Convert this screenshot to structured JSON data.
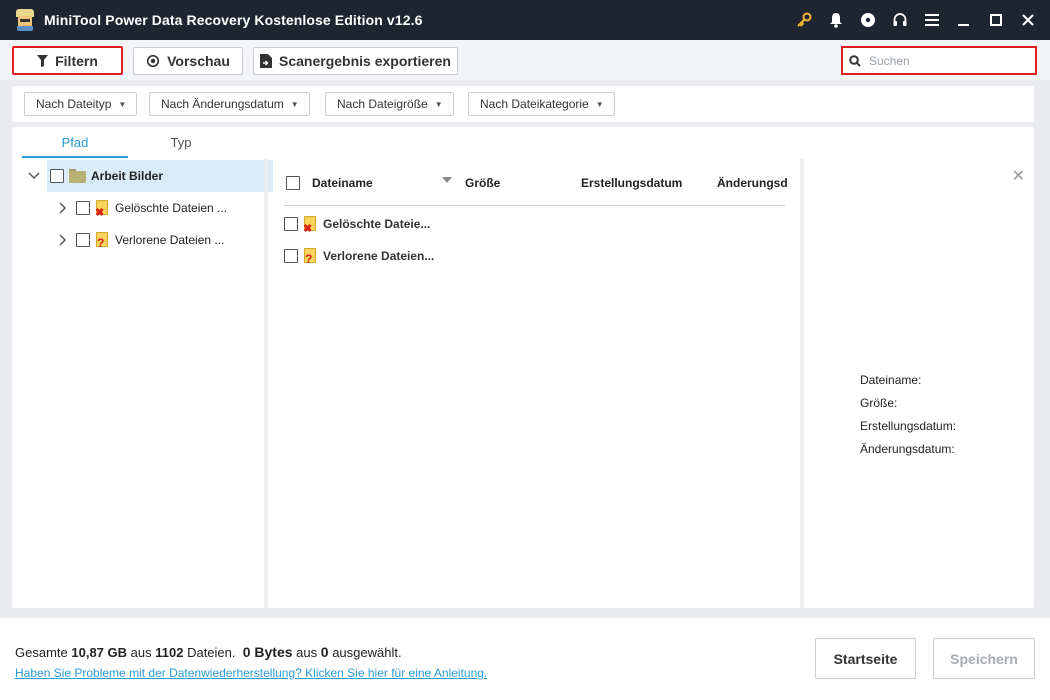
{
  "window": {
    "title": "MiniTool Power Data Recovery Kostenlose Edition v12.6",
    "icons": [
      "key-icon",
      "bell-icon",
      "disc-icon",
      "headset-icon",
      "menu-icon",
      "minimize-icon",
      "maximize-icon",
      "close-icon"
    ]
  },
  "toolbar": {
    "filter_label": "Filtern",
    "preview_label": "Vorschau",
    "export_label": "Scanergebnis exportieren",
    "search_placeholder": "Suchen",
    "search_value": ""
  },
  "filters": [
    {
      "label": "Nach Dateityp"
    },
    {
      "label": "Nach Änderungsdatum"
    },
    {
      "label": "Nach Dateigröße"
    },
    {
      "label": "Nach Dateikategorie"
    }
  ],
  "tabs": [
    {
      "label": "Pfad",
      "active": true
    },
    {
      "label": "Typ",
      "active": false
    }
  ],
  "tree": {
    "root": {
      "label": "Arbeit Bilder"
    },
    "children": [
      {
        "label": "Gelöschte Dateien ..."
      },
      {
        "label": "Verlorene Dateien ..."
      }
    ]
  },
  "list": {
    "columns": [
      "Dateiname",
      "Größe",
      "Erstellungsdatum",
      "Änderungsd"
    ],
    "rows": [
      {
        "name": "Gelöschte Dateie..."
      },
      {
        "name": "Verlorene Dateien..."
      }
    ]
  },
  "detail": {
    "labels": [
      "Dateiname:",
      "Größe:",
      "Erstellungsdatum:",
      "Änderungsdatum:"
    ]
  },
  "status": {
    "prefix": "Gesamte",
    "total_size": "10,87 GB",
    "mid1": "aus",
    "file_count": "1102",
    "mid2": "Dateien.",
    "selected_bytes": "0 Bytes",
    "mid3": "aus",
    "selected_count": "0",
    "suffix": "ausgewählt.",
    "help_link": "Haben Sie Probleme mit der Datenwiederherstellung? Klicken Sie hier für eine Anleitung."
  },
  "buttons": {
    "home_label": "Startseite",
    "save_label": "Speichern"
  },
  "colors": {
    "titlebar": "#1e2530",
    "accent": "#2b9bd6",
    "highlight": "#e02020",
    "selected_row": "#d9ecf8"
  }
}
